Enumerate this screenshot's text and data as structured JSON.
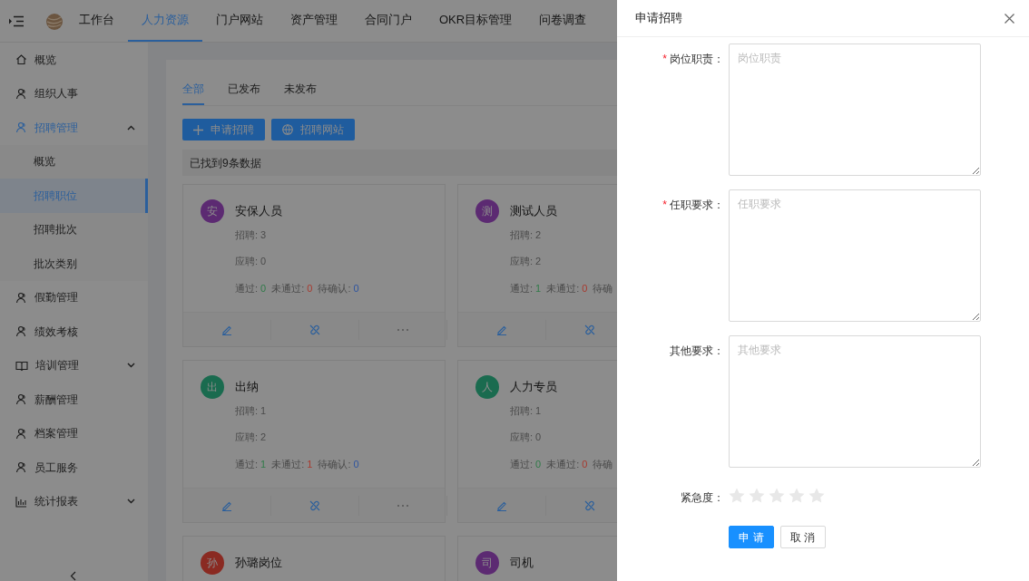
{
  "header": {
    "nav": [
      {
        "label": "工作台",
        "selected": false
      },
      {
        "label": "人力资源",
        "selected": true
      },
      {
        "label": "门户网站",
        "selected": false
      },
      {
        "label": "资产管理",
        "selected": false
      },
      {
        "label": "合同门户",
        "selected": false
      },
      {
        "label": "OKR目标管理",
        "selected": false
      },
      {
        "label": "问卷调查",
        "selected": false
      }
    ]
  },
  "sidebar": {
    "items": [
      {
        "label": "概览",
        "selected": false
      },
      {
        "label": "组织人事",
        "selected": false
      },
      {
        "label": "招聘管理",
        "selected": true,
        "expanded": true,
        "children": [
          {
            "label": "概览",
            "selected": false
          },
          {
            "label": "招聘职位",
            "selected": true
          },
          {
            "label": "招聘批次",
            "selected": false
          },
          {
            "label": "批次类别",
            "selected": false
          }
        ]
      },
      {
        "label": "假勤管理",
        "selected": false
      },
      {
        "label": "绩效考核",
        "selected": false
      },
      {
        "label": "培训管理",
        "selected": false,
        "expanded": false
      },
      {
        "label": "薪酬管理",
        "selected": false
      },
      {
        "label": "档案管理",
        "selected": false
      },
      {
        "label": "员工服务",
        "selected": false
      },
      {
        "label": "统计报表",
        "selected": false,
        "expanded": false
      }
    ]
  },
  "tabs": [
    {
      "label": "全部",
      "selected": true
    },
    {
      "label": "已发布",
      "selected": false
    },
    {
      "label": "未发布",
      "selected": false
    }
  ],
  "toolbar": {
    "buttons": [
      {
        "label": "申请招聘"
      },
      {
        "label": "招聘网站"
      }
    ]
  },
  "result_text": "已找到9条数据",
  "cards": [
    {
      "avatar": "安",
      "color": "#5c2a72",
      "title": "安保人员",
      "hire": "招聘: 3",
      "applied": "应聘: 0",
      "stats": [
        {
          "kind": "pass",
          "label": "通过:",
          "value": "0"
        },
        {
          "kind": "fail",
          "label": "未通过:",
          "value": "0"
        },
        {
          "kind": "pending",
          "label": "待确认:",
          "value": "0"
        }
      ]
    },
    {
      "avatar": "测",
      "color": "#5c2a72",
      "title": "测试人员",
      "hire": "招聘: 2",
      "applied": "应聘: 2",
      "stats": [
        {
          "kind": "pass",
          "label": "通过:",
          "value": "1"
        },
        {
          "kind": "fail",
          "label": "未通过:",
          "value": "0"
        },
        {
          "label": "待确"
        }
      ]
    },
    {
      "avatar": "出",
      "color": "#1a6b4f",
      "title": "出纳",
      "hire": "招聘: 1",
      "applied": "应聘: 2",
      "stats": [
        {
          "kind": "pass",
          "label": "通过:",
          "value": "1"
        },
        {
          "kind": "fail",
          "label": "未通过:",
          "value": "1"
        },
        {
          "kind": "pending",
          "label": "待确认:",
          "value": "0"
        }
      ]
    },
    {
      "avatar": "人",
      "color": "#1a6b4f",
      "title": "人力专员",
      "hire": "招聘: 1",
      "applied": "应聘: 0",
      "stats": [
        {
          "kind": "pass",
          "label": "通过:",
          "value": "0"
        },
        {
          "kind": "fail",
          "label": "未通过:",
          "value": "0"
        },
        {
          "label": "待确"
        }
      ]
    },
    {
      "avatar": "孙",
      "color": "#8a2a22",
      "title": "孙璐岗位"
    },
    {
      "avatar": "司",
      "color": "#5c2a72",
      "title": "司机"
    }
  ],
  "drawer": {
    "title": "申请招聘",
    "fields": [
      {
        "label": "岗位职责：",
        "mark": "*",
        "placeholder": "岗位职责"
      },
      {
        "label": "任职要求：",
        "mark": "*",
        "placeholder": "任职要求"
      },
      {
        "label": "其他要求：",
        "placeholder": "其他要求"
      }
    ],
    "rating": {
      "label": "紧急度：",
      "stars": 0
    },
    "buttons": [
      {
        "label": "申 请",
        "kind": "primary"
      },
      {
        "label": "取 消",
        "kind": "default"
      }
    ]
  }
}
